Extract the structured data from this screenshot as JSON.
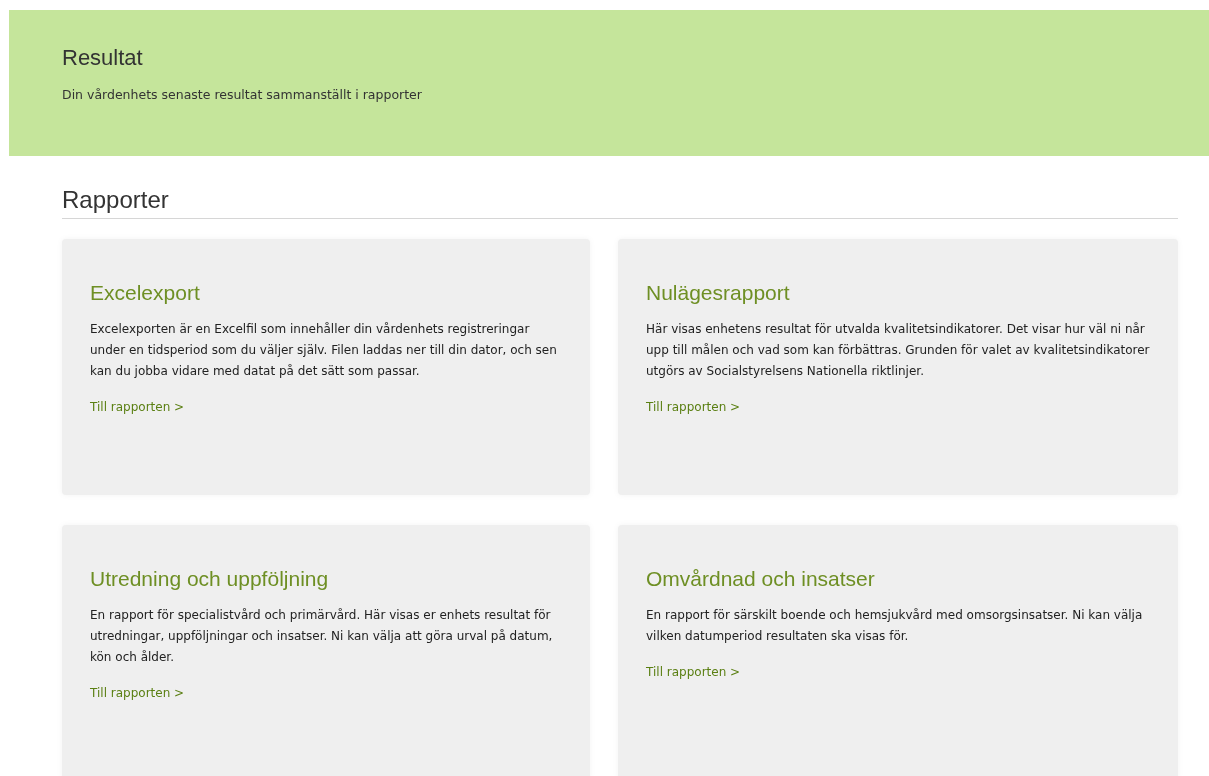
{
  "header": {
    "title": "Resultat",
    "subtitle": "Din vårdenhets senaste resultat sammanställt i rapporter"
  },
  "section": {
    "title": "Rapporter"
  },
  "cards": [
    {
      "title": "Excelexport",
      "text": "Excelexporten är en Excelfil som innehåller din vårdenhets registreringar under en tidsperiod som du väljer själv. Filen laddas ner till din dator, och sen kan du jobba vidare med datat på det sätt som passar.",
      "link": "Till rapporten >"
    },
    {
      "title": "Nulägesrapport",
      "text": "Här visas enhetens resultat för utvalda kvalitetsindikatorer. Det visar hur väl ni når upp till målen och vad som kan förbättras. Grunden för valet av kvalitetsindikatorer utgörs av Socialstyrelsens Nationella riktlinjer.",
      "link": "Till rapporten >"
    },
    {
      "title": "Utredning och uppföljning",
      "text": "En rapport för specialistvård och primärvård. Här visas er enhets resultat för utredningar, uppföljningar och insatser. Ni kan välja att göra urval på datum, kön och ålder.",
      "link": "Till rapporten >"
    },
    {
      "title": "Omvårdnad och insatser",
      "text": "En rapport för särskilt boende och hemsjukvård med omsorgsinsatser. Ni kan välja vilken datumperiod resultaten ska visas för.",
      "link": "Till rapporten >"
    }
  ]
}
